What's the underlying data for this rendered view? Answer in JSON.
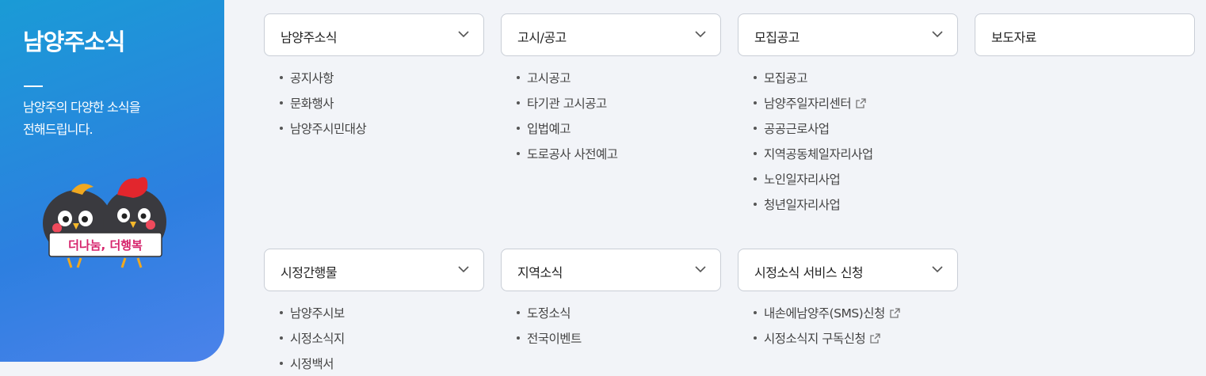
{
  "side": {
    "title": "남양주소식",
    "desc_line1": "남양주의 다양한 소식을",
    "desc_line2": "전해드립니다.",
    "mascot_banner": "더나눔, 더행복"
  },
  "categories": [
    {
      "label": "남양주소식",
      "items": [
        "공지사항",
        "문화행사",
        "남양주시민대상"
      ]
    },
    {
      "label": "고시/공고",
      "items": [
        "고시공고",
        "타기관 고시공고",
        "입법예고",
        "도로공사 사전예고"
      ]
    },
    {
      "label": "모집공고",
      "items": [
        "모집공고",
        "남양주일자리센터",
        "공공근로사업",
        "지역공동체일자리사업",
        "노인일자리사업",
        "청년일자리사업"
      ]
    },
    {
      "label": "보도자료"
    },
    {
      "label": "시정간행물",
      "items": [
        "남양주시보",
        "시정소식지",
        "시정백서"
      ]
    },
    {
      "label": "지역소식",
      "items": [
        "도정소식",
        "전국이벤트"
      ]
    },
    {
      "label": "시정소식 서비스 신청",
      "items": [
        "내손에남양주(SMS)신청",
        "시정소식지 구독신청"
      ]
    }
  ],
  "colors": {
    "accent": "#1a9bd6",
    "panel_bg": "#f2f4f8"
  }
}
